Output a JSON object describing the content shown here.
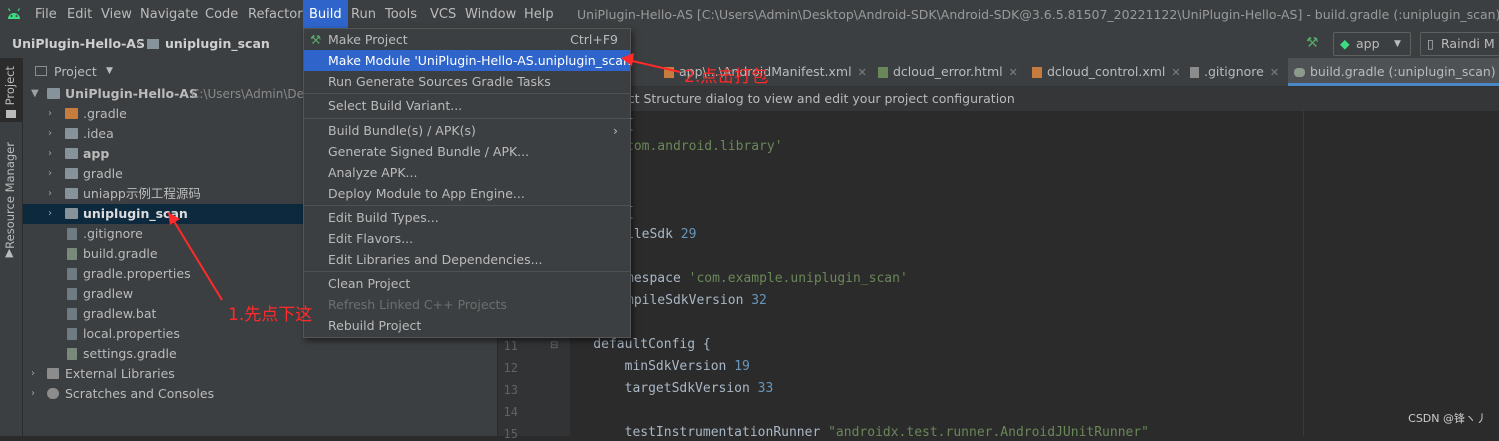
{
  "menubar": {
    "items": [
      "File",
      "Edit",
      "View",
      "Navigate",
      "Code",
      "Refactor",
      "Build",
      "Run",
      "Tools",
      "VCS",
      "Window",
      "Help"
    ],
    "window_title": "UniPlugin-Hello-AS [C:\\Users\\Admin\\Desktop\\Android-SDK\\Android-SDK@3.6.5.81507_20221122\\UniPlugin-Hello-AS] - build.gradle (:uniplugin_scan) - Administ"
  },
  "navbar": {
    "breadcrumb_project": "UniPlugin-Hello-AS",
    "breadcrumb_module": "uniplugin_scan",
    "run_config": "app",
    "device": "Raindi M"
  },
  "left_stripe": {
    "project_tab": "Project",
    "resource_tab": "Resource Manager"
  },
  "project_panel": {
    "title": "Project",
    "root_name": "UniPlugin-Hello-AS",
    "root_path": "C:\\Users\\Admin\\De",
    "items": [
      {
        "label": ".gradle"
      },
      {
        "label": ".idea"
      },
      {
        "label": "app"
      },
      {
        "label": "gradle"
      },
      {
        "label": "uniapp示例工程源码"
      },
      {
        "label": "uniplugin_scan"
      },
      {
        "label": ".gitignore"
      },
      {
        "label": "build.gradle"
      },
      {
        "label": "gradle.properties"
      },
      {
        "label": "gradlew"
      },
      {
        "label": "gradlew.bat"
      },
      {
        "label": "local.properties"
      },
      {
        "label": "settings.gradle"
      },
      {
        "label": "External Libraries"
      },
      {
        "label": "Scratches and Consoles"
      }
    ]
  },
  "editor": {
    "tabs": [
      {
        "label": ")"
      },
      {
        "label": "app\\...\\AndroidManifest.xml"
      },
      {
        "label": "dcloud_error.html"
      },
      {
        "label": "dcloud_control.xml"
      },
      {
        "label": ".gitignore"
      },
      {
        "label": "build.gradle (:uniplugin_scan)"
      }
    ],
    "banner": "ect Structure dialog to view and edit your project configuration",
    "code_lines": [
      {
        "no": "",
        "pre": "{",
        "str": "",
        "num": ""
      },
      {
        "no": "",
        "pre": "",
        "str": "com.android.library'",
        "num": ""
      },
      {
        "no": "",
        "pre": "",
        "str": "",
        "num": ""
      },
      {
        "no": "",
        "pre": "",
        "str": "",
        "num": ""
      },
      {
        "no": "",
        "pre": "{",
        "str": "",
        "num": ""
      },
      {
        "no": "",
        "pre": "ileSdk ",
        "str": "",
        "num": "29"
      },
      {
        "no": "",
        "pre": "",
        "str": "",
        "num": ""
      },
      {
        "no": "",
        "pre": "mespace ",
        "str": "'com.example.uniplugin_scan'",
        "num": ""
      },
      {
        "no": "",
        "pre": "mpileSdkVersion ",
        "str": "",
        "num": "32"
      },
      {
        "no": "",
        "pre": "",
        "str": "",
        "num": ""
      },
      {
        "no": "11",
        "pre": "    defaultConfig {",
        "str": "",
        "num": ""
      },
      {
        "no": "12",
        "pre": "        minSdkVersion ",
        "str": "",
        "num": "19"
      },
      {
        "no": "13",
        "pre": "        targetSdkVersion ",
        "str": "",
        "num": "33"
      },
      {
        "no": "14",
        "pre": "",
        "str": "",
        "num": ""
      },
      {
        "no": "15",
        "pre": "        testInstrumentationRunner ",
        "str": "\"androidx.test.runner.AndroidJUnitRunner\"",
        "num": ""
      }
    ]
  },
  "build_menu": {
    "items": [
      {
        "label": "Make Project",
        "shortcut": "Ctrl+F9"
      },
      {
        "label": "Make Module 'UniPlugin-Hello-AS.uniplugin_scan'",
        "shortcut": ""
      },
      {
        "label": "Run Generate Sources Gradle Tasks",
        "shortcut": ""
      },
      {
        "label": "Select Build Variant...",
        "shortcut": ""
      },
      {
        "label": "Build Bundle(s) / APK(s)",
        "shortcut": "›"
      },
      {
        "label": "Generate Signed Bundle / APK...",
        "shortcut": ""
      },
      {
        "label": "Analyze APK...",
        "shortcut": ""
      },
      {
        "label": "Deploy Module to App Engine...",
        "shortcut": ""
      },
      {
        "label": "Edit Build Types...",
        "shortcut": ""
      },
      {
        "label": "Edit Flavors...",
        "shortcut": ""
      },
      {
        "label": "Edit Libraries and Dependencies...",
        "shortcut": ""
      },
      {
        "label": "Clean Project",
        "shortcut": ""
      },
      {
        "label": "Refresh Linked C++ Projects",
        "shortcut": ""
      },
      {
        "label": "Rebuild Project",
        "shortcut": ""
      }
    ]
  },
  "annotations": {
    "step1": "1.先点下这",
    "step2": "2.点击打包"
  },
  "watermark": "CSDN @锋ヽ丿",
  "colors": {
    "accent": "#2f65ca",
    "annotation": "#ff2a2a",
    "selection": "#0d293e"
  }
}
